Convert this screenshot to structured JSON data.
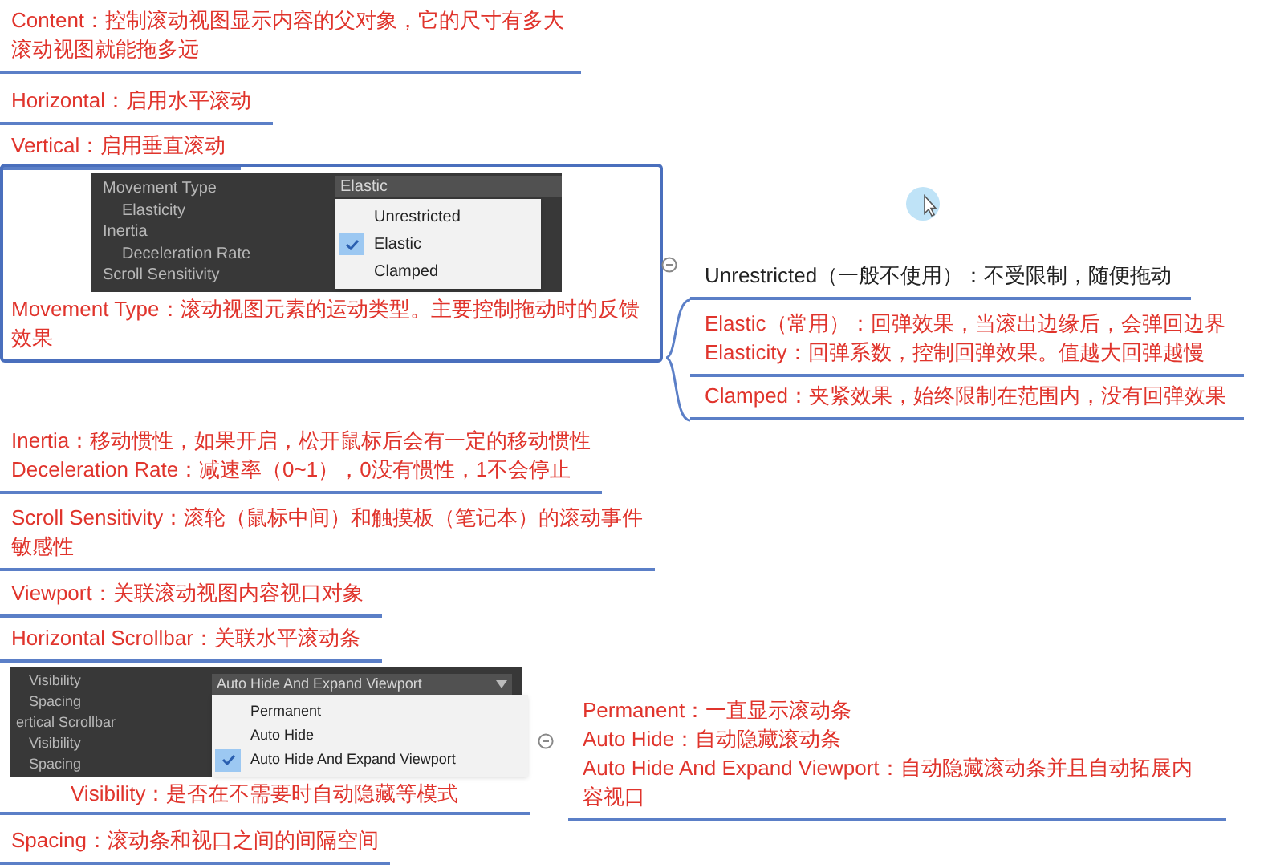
{
  "topics": [
    {
      "kind": "text",
      "selected": false,
      "lines": [
        "Content：控制滚动视图显示内容的父对象，它的尺寸有多大滚动视图就能拖多远"
      ]
    },
    {
      "kind": "text",
      "selected": false,
      "lines": [
        "Horizontal：启用水平滚动"
      ]
    },
    {
      "kind": "text",
      "selected": false,
      "lines": [
        "Vertical：启用垂直滚动"
      ]
    },
    {
      "kind": "image",
      "selected": true,
      "lines": [
        "Movement Type：滚动视图元素的运动类型。主要控制拖动时的反馈效果"
      ],
      "inspector": {
        "rows": [
          {
            "kind": "header",
            "label": "Movement Type"
          },
          {
            "kind": "child",
            "label": "Elasticity"
          },
          {
            "kind": "header",
            "label": "Inertia"
          },
          {
            "kind": "child",
            "label": "Deceleration Rate"
          },
          {
            "kind": "header",
            "label": "Scroll Sensitivity"
          }
        ],
        "field": {
          "value": "Elastic",
          "dropdown_arrow": false
        },
        "options": [
          {
            "label": "Unrestricted",
            "selected": false
          },
          {
            "label": "Elastic",
            "selected": true
          },
          {
            "label": "Clamped",
            "selected": false
          }
        ]
      },
      "subtopics": [
        {
          "color": "#222222",
          "lines": [
            "Unrestricted（一般不使用）：不受限制，随便拖动"
          ]
        },
        {
          "color": "#e0342c",
          "lines": [
            "Elastic（常用）：回弹效果，当滚出边缘后，会弹回边界",
            "Elasticity：回弹系数，控制回弹效果。值越大回弹越慢"
          ]
        },
        {
          "color": "#e0342c",
          "lines": [
            "Clamped：夹紧效果，始终限制在范围内，没有回弹效果"
          ]
        }
      ]
    },
    {
      "kind": "text",
      "selected": false,
      "lines": [
        "Inertia：移动惯性，如果开启，松开鼠标后会有一定的移动惯性",
        "Deceleration Rate：减速率（0~1），0没有惯性，1不会停止"
      ]
    },
    {
      "kind": "text",
      "selected": false,
      "lines": [
        "Scroll Sensitivity：滚轮（鼠标中间）和触摸板（笔记本）的滚动事件敏感性"
      ]
    },
    {
      "kind": "text",
      "selected": false,
      "lines": [
        "Viewport：关联滚动视图内容视口对象"
      ]
    },
    {
      "kind": "text",
      "selected": false,
      "lines": [
        "Horizontal Scrollbar：关联水平滚动条"
      ]
    },
    {
      "kind": "image",
      "selected": false,
      "lines": [
        "Visibility：是否在不需要时自动隐藏等模式"
      ],
      "inspector": {
        "rows": [
          {
            "kind": "child",
            "label": "Visibility"
          },
          {
            "kind": "child",
            "label": "Spacing"
          },
          {
            "kind": "header",
            "label": "ertical Scrollbar"
          },
          {
            "kind": "child",
            "label": "Visibility"
          },
          {
            "kind": "child",
            "label": "Spacing"
          }
        ],
        "field": {
          "value": "Auto Hide And Expand Viewport",
          "dropdown_arrow": true
        },
        "options": [
          {
            "label": "Permanent",
            "selected": false
          },
          {
            "label": "Auto Hide",
            "selected": false
          },
          {
            "label": "Auto Hide And Expand Viewport",
            "selected": true
          }
        ]
      },
      "subtopics": [
        {
          "color": "#e0342c",
          "lines": [
            "Permanent：一直显示滚动条",
            "Auto Hide：自动隐藏滚动条",
            "Auto Hide And Expand Viewport：自动隐藏滚动条并且自动拓展内容视口"
          ]
        }
      ]
    },
    {
      "kind": "text",
      "selected": false,
      "lines": [
        "Spacing：滚动条和视口之间的间隔空间"
      ]
    }
  ]
}
